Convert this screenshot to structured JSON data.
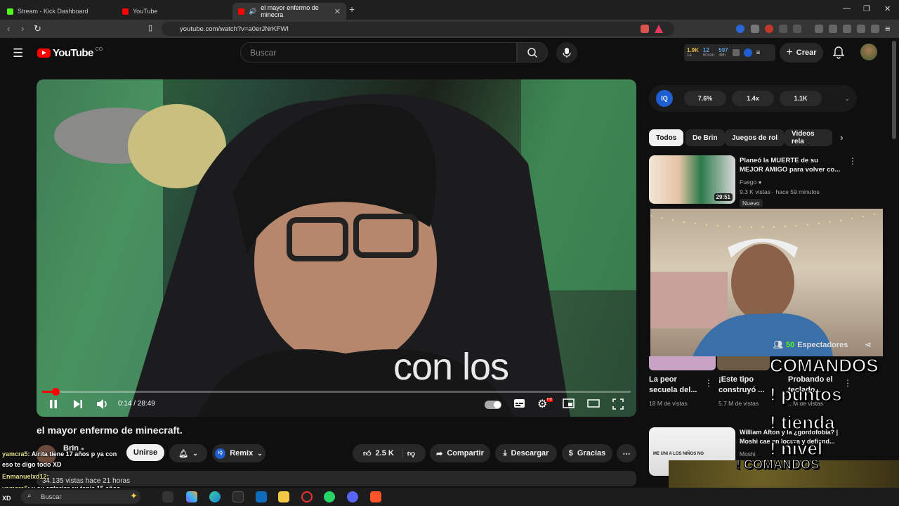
{
  "browser": {
    "tabs": [
      {
        "title": "Stream - Kick Dashboard",
        "color": "#53fc18"
      },
      {
        "title": "YouTube",
        "color": "#ff0000"
      },
      {
        "title": "el mayor enfermo de minecra",
        "color": "#ff0000"
      }
    ],
    "url": "youtube.com/watch?v=a0erJNrKFWI"
  },
  "youtube": {
    "logo": "YouTube",
    "logo_country": "CO",
    "search_placeholder": "Buscar",
    "stats": [
      {
        "value": "1.9K",
        "sub": "1a"
      },
      {
        "value": "12",
        "sub": "60min"
      },
      {
        "value": "597",
        "sub": "48h"
      }
    ],
    "create_label": "Crear"
  },
  "player": {
    "caption": "con los",
    "time": "0:14 / 28:49",
    "progress": 0.008
  },
  "video": {
    "title": "el mayor enfermo de minecraft.",
    "channel": "Brin",
    "join_label": "Unirse",
    "like_count": "2.5 K",
    "remix_label": "Remix",
    "share_label": "Compartir",
    "download_label": "Descargar",
    "thanks_label": "Gracias",
    "views_meta": "34.135 vistas  hace 21 horas"
  },
  "chat": [
    {
      "user": "yamcra5",
      "text": ": Airita tiene 17 años p ya con"
    },
    {
      "user": "",
      "text": "eso te digo todo XD"
    },
    {
      "user": "Enmanuelxd12",
      "text": ":"
    },
    {
      "user": "yamcra5",
      "text": ": y su anterior ex tenia 15 años"
    },
    {
      "user": "",
      "text": "XD"
    }
  ],
  "iq_panel": {
    "badge": "IQ",
    "values": [
      "7.6%",
      "1.4x",
      "1.1K"
    ]
  },
  "chips": [
    "Todos",
    "De Brin",
    "Juegos de rol",
    "Videos rela"
  ],
  "related": [
    {
      "title": "Planeó la MUERTE de su MEJOR AMIGO para volver co...",
      "channel": "Fuego",
      "meta": "9.3 K vistas · hace 59 minutos",
      "duration": "29:51",
      "badge": "Nuevo"
    },
    {
      "title": "La peor secuela del...",
      "meta": "18 M de vistas"
    },
    {
      "title": "¡Este tipo construyó ...",
      "meta": "5.7 M de vistas"
    },
    {
      "title": "Probando el teclado...",
      "meta": "...M de vistas"
    },
    {
      "title": "William Afton y la ¿gordofobia? | Moshi cae en locura y defiend...",
      "channel": "Moshi",
      "thumb_text": "ME UNI A LOS NIÑOS NO"
    }
  ],
  "overlay": {
    "viewers_count": "50",
    "viewers_label": "Espectadores",
    "commands": [
      "COMANDOS",
      "! puntos",
      "! tienda",
      "! nivel",
      "! COMANDOS"
    ]
  },
  "taskbar": {
    "search_placeholder": "Buscar"
  },
  "colors": {
    "accent_red": "#ff0000",
    "bg": "#0f0f0f"
  }
}
